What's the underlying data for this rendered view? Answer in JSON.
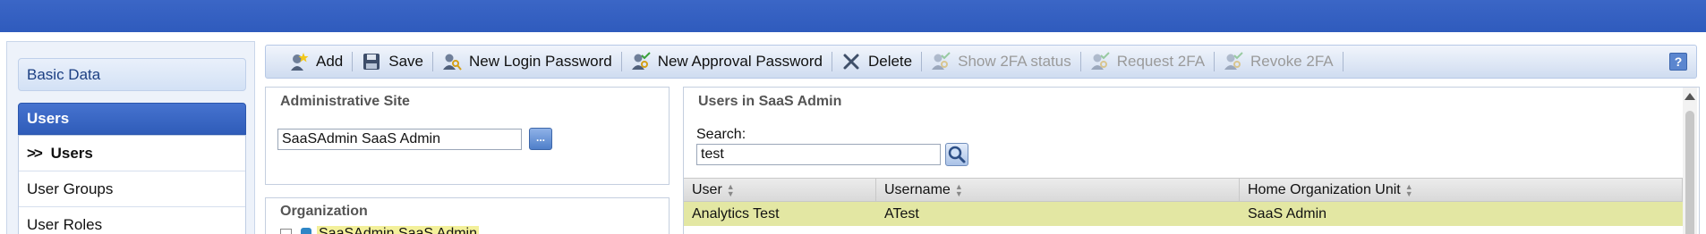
{
  "sidebar": {
    "basic_data_label": "Basic Data",
    "users_section_label": "Users",
    "items": [
      {
        "label": "Users",
        "active": true
      },
      {
        "label": "User Groups",
        "active": false
      },
      {
        "label": "User Roles",
        "active": false
      }
    ]
  },
  "toolbar": {
    "add_label": "Add",
    "save_label": "Save",
    "new_login_password_label": "New Login Password",
    "new_approval_password_label": "New Approval Password",
    "delete_label": "Delete",
    "show_2fa_label": "Show 2FA status",
    "request_2fa_label": "Request 2FA",
    "revoke_2fa_label": "Revoke 2FA",
    "help_label": "?"
  },
  "admin_site": {
    "title": "Administrative Site",
    "value": "SaaSAdmin SaaS Admin",
    "browse_label": "..."
  },
  "organization": {
    "title": "Organization",
    "root_label": "SaaSAdmin SaaS Admin"
  },
  "users_panel": {
    "title": "Users in SaaS Admin",
    "search_label": "Search:",
    "search_value": "test",
    "columns": [
      "User",
      "Username",
      "Home Organization Unit"
    ],
    "rows": [
      {
        "user": "Analytics Test",
        "username": "ATest",
        "home_org": "SaaS Admin",
        "selected": true
      }
    ]
  },
  "colors": {
    "top_bar": "#3b66c6",
    "selected_row": "#e3e7a3",
    "nav_active": "#2f5cb9",
    "highlight": "#f3f09a"
  }
}
